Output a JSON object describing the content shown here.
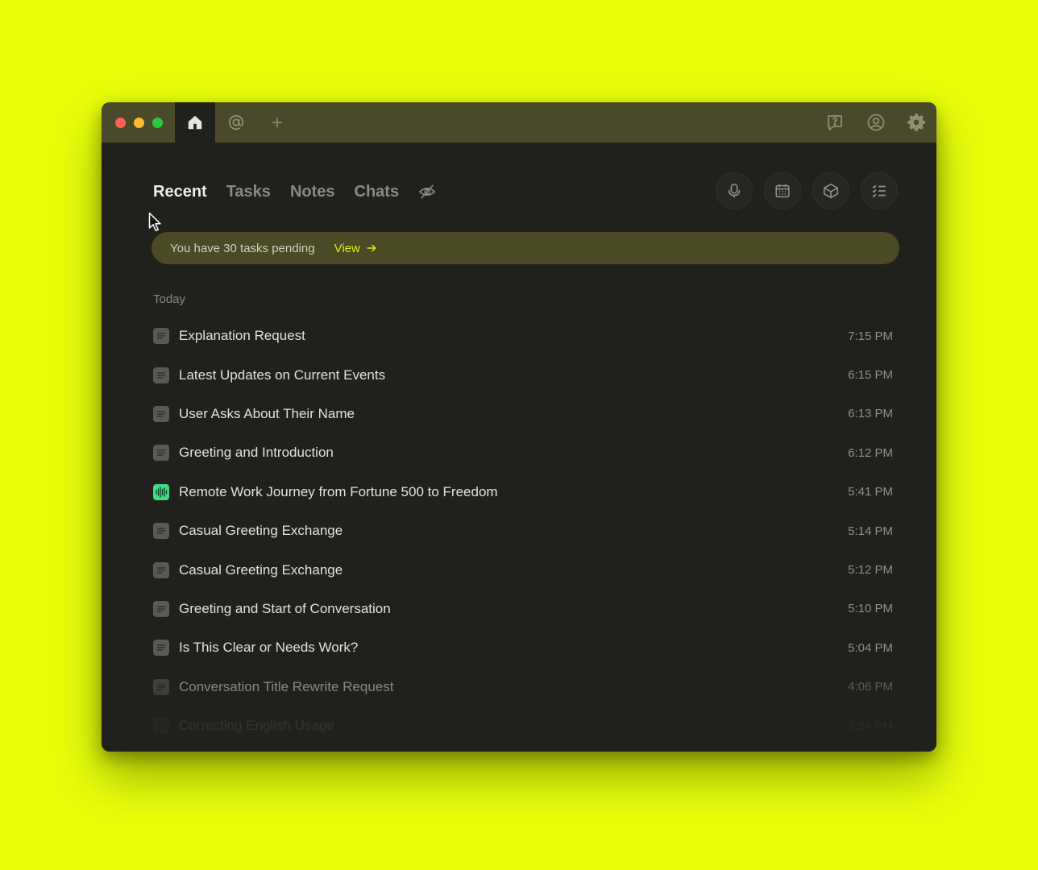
{
  "tabs": {
    "home_icon": "home-icon",
    "mention_icon": "at-icon",
    "new_tab_icon": "plus-icon"
  },
  "nav": {
    "items": [
      {
        "label": "Recent",
        "active": true
      },
      {
        "label": "Tasks",
        "active": false
      },
      {
        "label": "Notes",
        "active": false
      },
      {
        "label": "Chats",
        "active": false
      }
    ]
  },
  "banner": {
    "text": "You have 30 tasks pending",
    "link": "View"
  },
  "section": {
    "label": "Today"
  },
  "items": [
    {
      "title": "Explanation Request",
      "time": "7:15 PM",
      "type": "chat"
    },
    {
      "title": "Latest Updates on Current Events",
      "time": "6:15 PM",
      "type": "chat"
    },
    {
      "title": "User Asks About Their Name",
      "time": "6:13 PM",
      "type": "chat"
    },
    {
      "title": "Greeting and Introduction",
      "time": "6:12 PM",
      "type": "chat"
    },
    {
      "title": "Remote Work Journey from Fortune 500 to Freedom",
      "time": "5:41 PM",
      "type": "audio"
    },
    {
      "title": "Casual Greeting Exchange",
      "time": "5:14 PM",
      "type": "chat"
    },
    {
      "title": "Casual Greeting Exchange",
      "time": "5:12 PM",
      "type": "chat"
    },
    {
      "title": "Greeting and Start of Conversation",
      "time": "5:10 PM",
      "type": "chat"
    },
    {
      "title": "Is This Clear or Needs Work?",
      "time": "5:04 PM",
      "type": "chat"
    },
    {
      "title": "Conversation Title Rewrite Request",
      "time": "4:06 PM",
      "type": "chat"
    },
    {
      "title": "Correcting English Usage",
      "time": "3:24 PM",
      "type": "chat"
    }
  ],
  "colors": {
    "background": "#e8ff0a",
    "window": "#20211d",
    "titlebar": "#4a4a2a",
    "accent": "#d8f20c",
    "audio_icon": "#3ddc84"
  }
}
